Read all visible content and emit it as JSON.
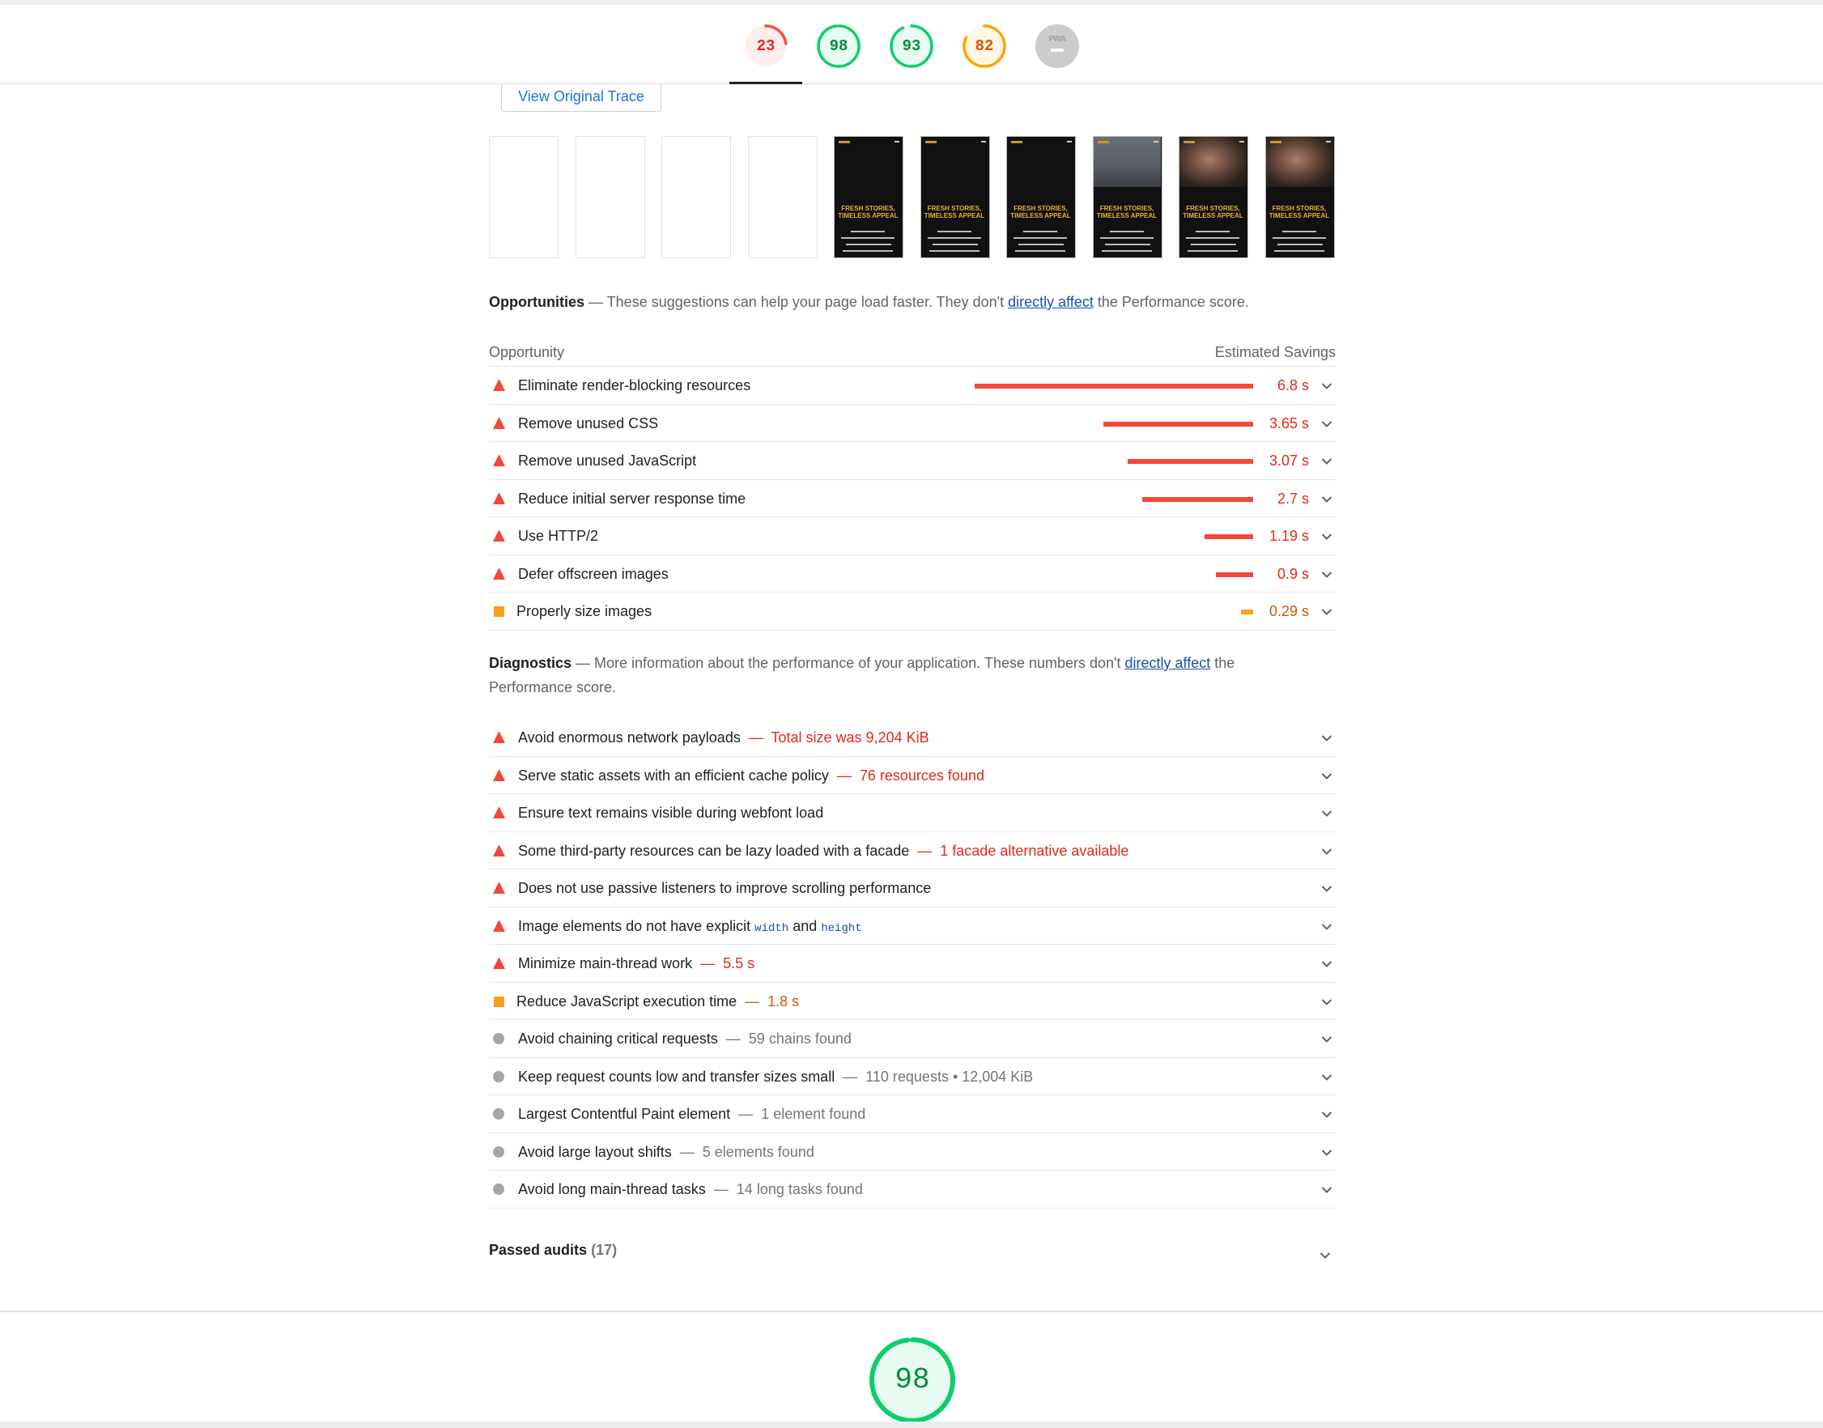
{
  "header": {
    "gauges": [
      {
        "score": "23",
        "status": "fail",
        "fraction": 0.23,
        "color": "#ff4e42",
        "bg": "#ffeeec"
      },
      {
        "score": "98",
        "status": "pass",
        "fraction": 0.98,
        "color": "#0cce6b",
        "bg": "#e7fbf0"
      },
      {
        "score": "93",
        "status": "pass",
        "fraction": 0.93,
        "color": "#0cce6b",
        "bg": "#e7fbf0"
      },
      {
        "score": "82",
        "status": "average",
        "fraction": 0.82,
        "color": "#ffa400",
        "bg": "#fff6e5"
      },
      {
        "label": "PWA",
        "status": "na",
        "color": "#cccccc"
      }
    ],
    "active_index": 0
  },
  "trace_button": "View Original Trace",
  "filmstrip": {
    "frames": [
      {
        "state": "blank"
      },
      {
        "state": "blank"
      },
      {
        "state": "blank"
      },
      {
        "state": "blank"
      },
      {
        "state": "dark",
        "photo": "none"
      },
      {
        "state": "dark",
        "photo": "none"
      },
      {
        "state": "dark",
        "photo": "none"
      },
      {
        "state": "dark",
        "photo": "city"
      },
      {
        "state": "dark",
        "photo": "face"
      },
      {
        "state": "dark",
        "photo": "face"
      }
    ],
    "headline_line1": "FRESH STORIES,",
    "headline_line2": "TIMELESS APPEAL"
  },
  "opportunities": {
    "heading": "Opportunities",
    "desc_before": " — These suggestions can help your page load faster. They don't ",
    "link": "directly affect",
    "desc_after": " the Performance score.",
    "col_left": "Opportunity",
    "col_right": "Estimated Savings",
    "items": [
      {
        "title": "Eliminate render-blocking resources",
        "saving": "6.8 s",
        "seconds": 6.8,
        "status": "fail"
      },
      {
        "title": "Remove unused CSS",
        "saving": "3.65 s",
        "seconds": 3.65,
        "status": "fail"
      },
      {
        "title": "Remove unused JavaScript",
        "saving": "3.07 s",
        "seconds": 3.07,
        "status": "fail"
      },
      {
        "title": "Reduce initial server response time",
        "saving": "2.7 s",
        "seconds": 2.7,
        "status": "fail"
      },
      {
        "title": "Use HTTP/2",
        "saving": "1.19 s",
        "seconds": 1.19,
        "status": "fail"
      },
      {
        "title": "Defer offscreen images",
        "saving": "0.9 s",
        "seconds": 0.9,
        "status": "fail"
      },
      {
        "title": "Properly size images",
        "saving": "0.29 s",
        "seconds": 0.29,
        "status": "average"
      }
    ]
  },
  "diagnostics": {
    "heading": "Diagnostics",
    "desc_before": " — More information about the performance of your application. These numbers don't ",
    "link": "directly affect",
    "desc_after": " the",
    "desc_line2": "Performance score.",
    "items": [
      {
        "title": "Avoid enormous network payloads",
        "detail": "Total size was 9,204 KiB",
        "status": "fail"
      },
      {
        "title": "Serve static assets with an efficient cache policy",
        "detail": "76 resources found",
        "status": "fail"
      },
      {
        "title": "Ensure text remains visible during webfont load",
        "detail": "",
        "status": "fail"
      },
      {
        "title": "Some third-party resources can be lazy loaded with a facade",
        "detail": "1 facade alternative available",
        "status": "fail"
      },
      {
        "title": "Does not use passive listeners to improve scrolling performance",
        "detail": "",
        "status": "fail"
      },
      {
        "title": "Image elements do not have explicit ",
        "code1": "width",
        "mid": " and ",
        "code2": "height",
        "detail": "",
        "status": "fail"
      },
      {
        "title": "Minimize main-thread work",
        "detail": "5.5 s",
        "status": "fail"
      },
      {
        "title": "Reduce JavaScript execution time",
        "detail": "1.8 s",
        "status": "average"
      },
      {
        "title": "Avoid chaining critical requests",
        "detail": "59 chains found",
        "status": "info"
      },
      {
        "title": "Keep request counts low and transfer sizes small",
        "detail": "110 requests • 12,004 KiB",
        "status": "info"
      },
      {
        "title": "Largest Contentful Paint element",
        "detail": "1 element found",
        "status": "info"
      },
      {
        "title": "Avoid large layout shifts",
        "detail": "5 elements found",
        "status": "info"
      },
      {
        "title": "Avoid long main-thread tasks",
        "detail": "14 long tasks found",
        "status": "info"
      }
    ]
  },
  "passed": {
    "label": "Passed audits",
    "count": "(17)"
  },
  "next_category": {
    "score": "98",
    "fraction": 0.98,
    "color": "#0cce6b",
    "bg": "#e7fbf0"
  }
}
